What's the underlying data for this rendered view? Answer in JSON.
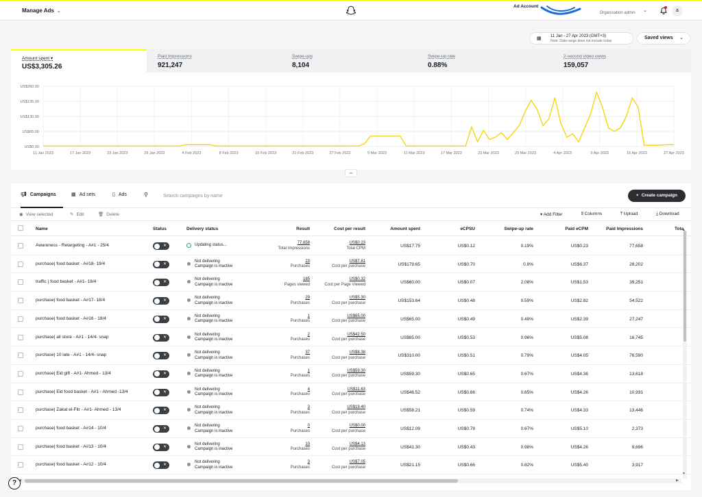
{
  "header": {
    "manage_ads": "Manage Ads",
    "account_name": "Ad Account",
    "account_sub": "Organisation admin",
    "avatar_letter": "a",
    "brand_color": "#fffc00"
  },
  "date_range": {
    "text": "11 Jan - 27 Apr 2023 (GMT+3)",
    "note": "Note: Date range does not include today",
    "saved_views": "Saved views"
  },
  "metrics": [
    {
      "label": "Amount spent ▾",
      "value": "US$3,305.26"
    },
    {
      "label": "Paid Impressions",
      "value": "921,247"
    },
    {
      "label": "Swipe-ups",
      "value": "8,104"
    },
    {
      "label": "Swipe-up rate",
      "value": "0.88%"
    },
    {
      "label": "2-second video views",
      "value": "159,057"
    }
  ],
  "chart_data": {
    "type": "line",
    "yticks": [
      "US$260.00",
      "US$195.00",
      "US$130.00",
      "US$65.00",
      "US$0.00"
    ],
    "ylim": [
      0,
      260
    ],
    "xticks": [
      "11 Jan 2023",
      "17 Jan 2023",
      "23 Jan 2023",
      "29 Jan 2023",
      "4 Feb 2023",
      "8 Feb 2023",
      "15 Feb 2023",
      "21 Feb 2023",
      "27 Feb 2023",
      "5 Mar 2023",
      "11 Mar 2023",
      "17 Mar 2023",
      "23 Mar 2023",
      "29 Mar 2023",
      "4 Apr 2023",
      "9 Apr 2023",
      "15 Apr 2023",
      "27 Apr 2023"
    ],
    "x": [
      "11 Jan",
      "17 Jan",
      "23 Jan",
      "29 Jan",
      "31 Jan",
      "3 Feb",
      "4 Feb",
      "5 Feb",
      "8 Feb",
      "9 Feb",
      "15 Feb",
      "21 Feb",
      "27 Feb",
      "5 Mar",
      "6 Mar",
      "7 Mar",
      "11 Mar",
      "12 Mar",
      "13 Mar",
      "17 Mar",
      "21 Mar",
      "22 Mar",
      "23 Mar",
      "24 Mar",
      "25 Mar",
      "26 Mar",
      "27 Mar",
      "28 Mar",
      "29 Mar",
      "30 Mar",
      "31 Mar",
      "1 Apr",
      "2 Apr",
      "3 Apr",
      "4 Apr",
      "5 Apr",
      "6 Apr",
      "7 Apr",
      "8 Apr",
      "9 Apr",
      "10 Apr",
      "11 Apr",
      "12 Apr",
      "13 Apr",
      "14 Apr",
      "15 Apr",
      "16 Apr",
      "17 Apr",
      "18 Apr",
      "19 Apr",
      "20 Apr",
      "21 Apr",
      "22 Apr",
      "24 Apr",
      "26 Apr",
      "27 Apr"
    ],
    "values": [
      2,
      2,
      2,
      2,
      2,
      2,
      8,
      8,
      8,
      2,
      2,
      2,
      2,
      2,
      12,
      45,
      45,
      45,
      2,
      2,
      2,
      2,
      2,
      85,
      20,
      70,
      30,
      40,
      60,
      30,
      60,
      90,
      150,
      200,
      160,
      90,
      120,
      210,
      100,
      40,
      55,
      20,
      80,
      140,
      235,
      170,
      80,
      65,
      80,
      130,
      210,
      170,
      5,
      5,
      8,
      8
    ],
    "line_color": "#f5d60a"
  },
  "tabs": {
    "campaigns": "Campaigns",
    "ad_sets": "Ad sets",
    "ads": "Ads",
    "search_placeholder": "Search campaigns by name",
    "create": "Create campaign"
  },
  "actions": {
    "view_selected": "View selected",
    "edit": "Edit",
    "delete": "Delete",
    "add_filter": "Add Filter",
    "columns": "Columns",
    "upload": "Upload",
    "download": "Download"
  },
  "columns": {
    "name": "Name",
    "status": "Status",
    "delivery": "Delivery status",
    "result": "Result",
    "cpr": "Cost per result",
    "amount": "Amount spent",
    "ecpsu": "eCPSU",
    "swipe_rate": "Swipe-up rate",
    "paid_ecpm": "Paid eCPM",
    "paid_impr": "Paid Impressions",
    "total": "Tota"
  },
  "rows": [
    {
      "name": "Awareness - Retargeting - A#1 - 25/4",
      "delivery_main": "Updating status...",
      "delivery_sub": "",
      "updating": true,
      "result": "77,658",
      "result_unit": "Total Impressions",
      "cpr": "US$0.23",
      "cpr_unit": "Total CPM",
      "amount": "US$17.75",
      "ecpsu": "US$0.12",
      "swipe_rate": "0.19%",
      "paid_ecpm": "US$0.23",
      "paid_impr": "77,658"
    },
    {
      "name": "purchase| food basket - A#18- 19/4",
      "delivery_main": "Not delivering",
      "delivery_sub": "Campaign is inactive",
      "updating": false,
      "result": "23",
      "result_unit": "Purchases",
      "cpr": "US$7.81",
      "cpr_unit": "Cost per purchase",
      "amount": "US$179.65",
      "ecpsu": "US$0.70",
      "swipe_rate": "0.9%",
      "paid_ecpm": "US$6.37",
      "paid_impr": "28,202"
    },
    {
      "name": "traffic | food basket - A#1- 18/4",
      "delivery_main": "Not delivering",
      "delivery_sub": "Campaign is inactive",
      "updating": false,
      "result": "185",
      "result_unit": "Pages viewed",
      "cpr": "US$0.32",
      "cpr_unit": "Cost per Page Viewed",
      "amount": "US$60.00",
      "ecpsu": "US$0.07",
      "swipe_rate": "2.08%",
      "paid_ecpm": "US$1.53",
      "paid_impr": "39,251"
    },
    {
      "name": "purchase| food basket - A#17- 18/4",
      "delivery_main": "Not delivering",
      "delivery_sub": "Campaign is inactive",
      "updating": false,
      "result": "29",
      "result_unit": "Purchases",
      "cpr": "US$5.30",
      "cpr_unit": "Cost per purchase",
      "amount": "US$153.64",
      "ecpsu": "US$0.48",
      "swipe_rate": "0.59%",
      "paid_ecpm": "US$2.82",
      "paid_impr": "54,522"
    },
    {
      "name": "purchase| food basket - A#16 - 18/4",
      "delivery_main": "Not delivering",
      "delivery_sub": "Campaign is inactive",
      "updating": false,
      "result": "1",
      "result_unit": "Purchases",
      "cpr": "US$65.00",
      "cpr_unit": "Cost per purchase",
      "amount": "US$65.00",
      "ecpsu": "US$0.49",
      "swipe_rate": "0.49%",
      "paid_ecpm": "US$2.39",
      "paid_impr": "27,247"
    },
    {
      "name": "purchase| all store - A#1 - 14/4- snap",
      "delivery_main": "Not delivering",
      "delivery_sub": "Campaign is inactive",
      "updating": false,
      "result": "2",
      "result_unit": "Purchases",
      "cpr": "US$42.50",
      "cpr_unit": "Cost per purchase",
      "amount": "US$85.00",
      "ecpsu": "US$0.53",
      "swipe_rate": "0.96%",
      "paid_ecpm": "US$5.08",
      "paid_impr": "16,745"
    },
    {
      "name": "purchase| 10 late - A#1 - 14/4- snap",
      "delivery_main": "Not delivering",
      "delivery_sub": "Campaign is inactive",
      "updating": false,
      "result": "37",
      "result_unit": "Purchases",
      "cpr": "US$8.38",
      "cpr_unit": "Cost per purchase",
      "amount": "US$310.00",
      "ecpsu": "US$0.51",
      "swipe_rate": "0.79%",
      "paid_ecpm": "US$4.05",
      "paid_impr": "76,590"
    },
    {
      "name": "purchase| Eid gift - A#1- Ahmed - 13/4",
      "delivery_main": "Not delivering",
      "delivery_sub": "Campaign is inactive",
      "updating": false,
      "result": "1",
      "result_unit": "Purchases",
      "cpr": "US$59.30",
      "cpr_unit": "Cost per purchase",
      "amount": "US$59.30",
      "ecpsu": "US$0.65",
      "swipe_rate": "0.67%",
      "paid_ecpm": "US$4.36",
      "paid_impr": "13,618"
    },
    {
      "name": "purchase| Eid food basket - A#1 - Ahmed -13/4",
      "delivery_main": "Not delivering",
      "delivery_sub": "Campaign is inactive",
      "updating": false,
      "result": "4",
      "result_unit": "Purchases",
      "cpr": "US$11.63",
      "cpr_unit": "Cost per purchase",
      "amount": "US$46.52",
      "ecpsu": "US$0.66",
      "swipe_rate": "0.65%",
      "paid_ecpm": "US$4.26",
      "paid_impr": "10,931"
    },
    {
      "name": "purchase| Zakat el-Fitr - A#1- Ahmed - 13/4",
      "delivery_main": "Not delivering",
      "delivery_sub": "Campaign is inactive",
      "updating": false,
      "result": "3",
      "result_unit": "Purchases",
      "cpr": "US$19.40",
      "cpr_unit": "Cost per purchase",
      "amount": "US$58.21",
      "ecpsu": "US$0.59",
      "swipe_rate": "0.74%",
      "paid_ecpm": "US$4.33",
      "paid_impr": "13,446"
    },
    {
      "name": "purchase| food basket - A#14 - 10/4",
      "delivery_main": "Not delivering",
      "delivery_sub": "Campaign is inactive",
      "updating": false,
      "result": "0",
      "result_unit": "Purchases",
      "cpr": "US$0.00",
      "cpr_unit": "Cost per purchase",
      "amount": "US$12.09",
      "ecpsu": "US$0.78",
      "swipe_rate": "0.67%",
      "paid_ecpm": "US$5.10",
      "paid_impr": "2,373"
    },
    {
      "name": "purchase| food basket - A#13 - 10/4",
      "delivery_main": "Not delivering",
      "delivery_sub": "Campaign is inactive",
      "updating": false,
      "result": "10",
      "result_unit": "Purchases",
      "cpr": "US$4.13",
      "cpr_unit": "Cost per purchase",
      "amount": "US$41.30",
      "ecpsu": "US$0.43",
      "swipe_rate": "0.98%",
      "paid_ecpm": "US$4.26",
      "paid_impr": "9,696"
    },
    {
      "name": "purchase| food basket - A#12 - 10/4",
      "delivery_main": "Not delivering",
      "delivery_sub": "Campaign is inactive",
      "updating": false,
      "result": "3",
      "result_unit": "Purchases",
      "cpr": "US$7.05",
      "cpr_unit": "Cost per purchase",
      "amount": "US$21.15",
      "ecpsu": "US$0.66",
      "swipe_rate": "0.82%",
      "paid_ecpm": "US$5.40",
      "paid_impr": "3,917"
    }
  ]
}
